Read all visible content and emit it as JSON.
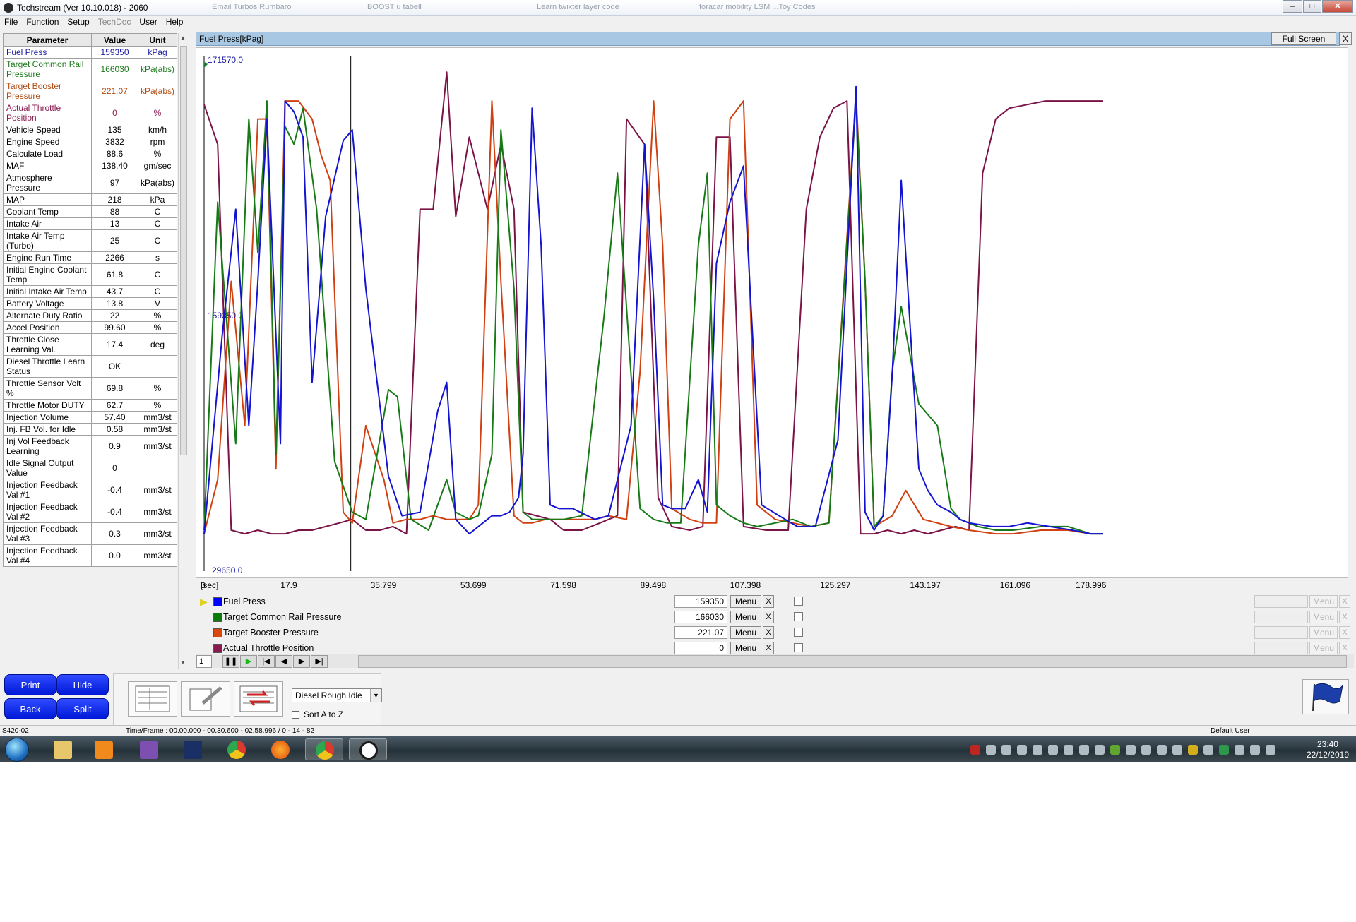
{
  "window": {
    "title": "Techstream (Ver 10.10.018) - 2060",
    "background_tabs": [
      "Email Turbos Rumbaro",
      "BOOST u tabell",
      "Learn twixter layer code",
      "foracar mobility LSM ...Toy Codes"
    ]
  },
  "menu": {
    "file": "File",
    "function": "Function",
    "setup": "Setup",
    "techdoc": "TechDoc",
    "user": "User",
    "help": "Help"
  },
  "table": {
    "headers": {
      "parameter": "Parameter",
      "value": "Value",
      "unit": "Unit"
    },
    "rows": [
      {
        "p": "Fuel Press",
        "v": "159350",
        "u": "kPag",
        "color": "#1a1aa0"
      },
      {
        "p": "Target Common Rail Pressure",
        "v": "166030",
        "u": "kPa(abs)",
        "color": "#1d7a1d"
      },
      {
        "p": "Target Booster Pressure",
        "v": "221.07",
        "u": "kPa(abs)",
        "color": "#b24a12"
      },
      {
        "p": "Actual Throttle Position",
        "v": "0",
        "u": "%",
        "color": "#8a1a4e"
      },
      {
        "p": "Vehicle Speed",
        "v": "135",
        "u": "km/h",
        "color": "#000000"
      },
      {
        "p": "Engine Speed",
        "v": "3832",
        "u": "rpm",
        "color": "#000000"
      },
      {
        "p": "Calculate Load",
        "v": "88.6",
        "u": "%",
        "color": "#000000"
      },
      {
        "p": "MAF",
        "v": "138.40",
        "u": "gm/sec",
        "color": "#000000"
      },
      {
        "p": "Atmosphere Pressure",
        "v": "97",
        "u": "kPa(abs)",
        "color": "#000000"
      },
      {
        "p": "MAP",
        "v": "218",
        "u": "kPa",
        "color": "#000000"
      },
      {
        "p": "Coolant Temp",
        "v": "88",
        "u": "C",
        "color": "#000000"
      },
      {
        "p": "Intake Air",
        "v": "13",
        "u": "C",
        "color": "#000000"
      },
      {
        "p": "Intake Air Temp (Turbo)",
        "v": "25",
        "u": "C",
        "color": "#000000"
      },
      {
        "p": "Engine Run Time",
        "v": "2266",
        "u": "s",
        "color": "#000000"
      },
      {
        "p": "Initial Engine Coolant Temp",
        "v": "61.8",
        "u": "C",
        "color": "#000000"
      },
      {
        "p": "Initial Intake Air Temp",
        "v": "43.7",
        "u": "C",
        "color": "#000000"
      },
      {
        "p": "Battery Voltage",
        "v": "13.8",
        "u": "V",
        "color": "#000000"
      },
      {
        "p": "Alternate Duty Ratio",
        "v": "22",
        "u": "%",
        "color": "#000000"
      },
      {
        "p": "Accel Position",
        "v": "99.60",
        "u": "%",
        "color": "#000000"
      },
      {
        "p": "Throttle Close Learning Val.",
        "v": "17.4",
        "u": "deg",
        "color": "#000000"
      },
      {
        "p": "Diesel Throttle Learn Status",
        "v": "OK",
        "u": "",
        "color": "#000000"
      },
      {
        "p": "Throttle Sensor Volt %",
        "v": "69.8",
        "u": "%",
        "color": "#000000"
      },
      {
        "p": "Throttle Motor DUTY",
        "v": "62.7",
        "u": "%",
        "color": "#000000"
      },
      {
        "p": "Injection Volume",
        "v": "57.40",
        "u": "mm3/st",
        "color": "#000000"
      },
      {
        "p": "Inj. FB Vol. for Idle",
        "v": "0.58",
        "u": "mm3/st",
        "color": "#000000"
      },
      {
        "p": "Inj Vol Feedback Learning",
        "v": "0.9",
        "u": "mm3/st",
        "color": "#000000"
      },
      {
        "p": "Idle Signal Output Value",
        "v": "0",
        "u": "",
        "color": "#000000"
      },
      {
        "p": "Injection Feedback Val #1",
        "v": "-0.4",
        "u": "mm3/st",
        "color": "#000000"
      },
      {
        "p": "Injection Feedback Val #2",
        "v": "-0.4",
        "u": "mm3/st",
        "color": "#000000"
      },
      {
        "p": "Injection Feedback Val #3",
        "v": "0.3",
        "u": "mm3/st",
        "color": "#000000"
      },
      {
        "p": "Injection Feedback Val #4",
        "v": "0.0",
        "u": "mm3/st",
        "color": "#000000"
      }
    ]
  },
  "graph": {
    "title": "Fuel Press[kPag]",
    "full_screen_label": "Full Screen",
    "close_label": "X",
    "cursor_time": 29.2
  },
  "chart_data": {
    "type": "line",
    "ylim": [
      29650.0,
      171570.0
    ],
    "y_ticks": [
      "171570.0",
      "159350.0",
      "29650.0"
    ],
    "xlim": [
      0,
      178.996
    ],
    "x_unit_label": "[sec]",
    "x_ticks": [
      "0",
      "17.9",
      "35.799",
      "53.699",
      "71.598",
      "89.498",
      "107.398",
      "125.297",
      "143.197",
      "161.096",
      "178.996"
    ],
    "grid": false,
    "series": [
      {
        "name": "Fuel Press",
        "color": "#1414d0",
        "x": [
          0,
          3.6,
          6.3,
          8.9,
          10.7,
          12.5,
          15.2,
          16.1,
          17.9,
          19.7,
          21.5,
          24.2,
          27.7,
          29.5,
          32.2,
          36.7,
          39.4,
          43.0,
          46.5,
          48.3,
          50.1,
          52.8,
          55.5,
          57.3,
          59.1,
          60.8,
          62.6,
          63.5,
          65.3,
          67.1,
          68.9,
          70.7,
          73.4,
          77.8,
          80.5,
          85.0,
          87.7,
          89.5,
          91.3,
          93.1,
          95.8,
          98.4,
          100.2,
          102.0,
          104.7,
          107.4,
          111.0,
          114.5,
          118.1,
          121.7,
          126.2,
          129.8,
          131.6,
          133.4,
          135.2,
          137.0,
          138.8,
          142.3,
          144.1,
          146.0,
          148.7,
          150.5,
          152.3,
          156.8,
          160.3,
          163.9,
          168.4,
          172.9,
          176.5,
          179.0
        ],
        "y": [
          40000,
          95000,
          130000,
          70000,
          110000,
          155000,
          65000,
          160000,
          157000,
          150000,
          82000,
          128000,
          149000,
          152000,
          108000,
          56000,
          45000,
          46000,
          74000,
          82000,
          44000,
          40000,
          43000,
          45000,
          45000,
          46000,
          50000,
          62000,
          158000,
          120000,
          48000,
          47000,
          47000,
          44000,
          45000,
          70000,
          148000,
          105000,
          48000,
          47000,
          47000,
          55000,
          46000,
          115000,
          132000,
          142000,
          48000,
          45000,
          42000,
          42000,
          66000,
          164000,
          46000,
          41000,
          45000,
          84000,
          138000,
          58000,
          52000,
          48000,
          46000,
          44000,
          43000,
          42000,
          42000,
          43000,
          42000,
          41000,
          40000,
          40000
        ]
      },
      {
        "name": "Target Common Rail Pressure",
        "color": "#177a17",
        "x": [
          0,
          2.7,
          6.3,
          8.9,
          10.7,
          12.5,
          14.3,
          16.1,
          17.9,
          19.7,
          22.4,
          26.0,
          29.5,
          32.2,
          36.7,
          38.5,
          41.2,
          44.7,
          48.3,
          50.1,
          52.8,
          54.6,
          57.3,
          59.1,
          61.7,
          63.5,
          65.3,
          67.1,
          68.9,
          71.6,
          75.2,
          79.6,
          82.3,
          86.8,
          89.5,
          92.2,
          94.9,
          98.4,
          100.2,
          102.0,
          104.7,
          107.4,
          110.1,
          113.7,
          117.2,
          120.8,
          124.4,
          129.8,
          131.6,
          133.4,
          135.2,
          137.0,
          138.8,
          142.3,
          146.0,
          148.7,
          150.5,
          154.1,
          157.6,
          161.1,
          166.6,
          172.0,
          176.5,
          179.0
        ],
        "y": [
          41000,
          132000,
          65000,
          155000,
          118000,
          160000,
          62000,
          153000,
          148000,
          158000,
          130000,
          60000,
          46000,
          44000,
          80000,
          78000,
          44000,
          41000,
          55000,
          46000,
          44000,
          45000,
          62000,
          152000,
          108000,
          46000,
          44000,
          44000,
          44000,
          44000,
          45000,
          100000,
          140000,
          47000,
          44000,
          43000,
          43000,
          120000,
          140000,
          48000,
          45000,
          43000,
          42000,
          43000,
          44000,
          42000,
          43000,
          160000,
          110000,
          42000,
          45000,
          85000,
          103000,
          76000,
          70000,
          47000,
          44000,
          42000,
          41000,
          41000,
          42000,
          42000,
          40000,
          40000
        ]
      },
      {
        "name": "Target Booster Pressure",
        "color": "#d04010",
        "x": [
          0,
          2.7,
          5.4,
          8.1,
          10.7,
          12.5,
          14.3,
          16.1,
          18.8,
          21.5,
          23.3,
          25.1,
          27.7,
          29.5,
          32.2,
          35.8,
          37.6,
          40.3,
          43.0,
          45.6,
          48.3,
          50.1,
          52.8,
          54.6,
          57.3,
          59.1,
          61.7,
          63.5,
          65.3,
          68.0,
          70.7,
          73.4,
          77.8,
          80.5,
          84.1,
          86.8,
          89.5,
          91.3,
          93.1,
          96.7,
          99.3,
          102.0,
          104.7,
          107.4,
          110.1,
          113.7,
          117.2,
          120.8,
          124.4,
          129.8,
          131.6,
          133.4,
          137.0,
          139.7,
          143.2,
          146.0,
          148.7,
          152.3,
          157.6,
          161.1,
          166.6,
          172.0,
          176.5,
          179.0
        ],
        "y": [
          40000,
          55000,
          110000,
          70000,
          155000,
          155000,
          58000,
          160000,
          160000,
          155000,
          145000,
          138000,
          46000,
          43000,
          70000,
          55000,
          43000,
          44000,
          44000,
          45000,
          44000,
          44000,
          44000,
          48000,
          160000,
          110000,
          45000,
          43000,
          43000,
          44000,
          44000,
          44000,
          44000,
          45000,
          44000,
          85000,
          160000,
          120000,
          47000,
          44000,
          43000,
          43000,
          155000,
          160000,
          48000,
          44000,
          43000,
          42000,
          43000,
          162000,
          110000,
          42000,
          45000,
          52000,
          44000,
          43000,
          42000,
          41000,
          40000,
          40000,
          41000,
          41000,
          40000,
          40000
        ]
      },
      {
        "name": "Actual Throttle Position",
        "color": "#7a1346",
        "x": [
          0,
          2.7,
          5.4,
          8.1,
          10.7,
          13.4,
          16.1,
          18.8,
          21.5,
          24.2,
          26.9,
          29.5,
          32.2,
          35.0,
          37.6,
          40.3,
          43.0,
          45.6,
          48.3,
          50.1,
          52.8,
          56.4,
          59.1,
          61.7,
          63.5,
          66.2,
          68.9,
          71.6,
          75.2,
          78.8,
          82.3,
          84.1,
          87.7,
          90.4,
          93.1,
          96.7,
          99.3,
          102.0,
          104.7,
          107.4,
          111.9,
          116.3,
          119.9,
          122.6,
          125.3,
          128.0,
          130.7,
          133.4,
          136.1,
          138.8,
          141.4,
          144.1,
          146.8,
          149.6,
          152.3,
          155.0,
          157.6,
          160.3,
          163.9,
          167.5,
          171.0,
          174.6,
          177.3,
          179.0
        ],
        "y": [
          159000,
          148000,
          41000,
          40000,
          41000,
          40000,
          40000,
          41000,
          41000,
          42000,
          43000,
          44000,
          41000,
          41000,
          42000,
          40000,
          130000,
          130000,
          168000,
          128000,
          150000,
          130000,
          148000,
          130000,
          46000,
          45000,
          44000,
          41000,
          41000,
          43000,
          45000,
          155000,
          148000,
          50000,
          42000,
          41000,
          42000,
          150000,
          150000,
          42000,
          41000,
          41000,
          130000,
          150000,
          158000,
          160000,
          40000,
          40000,
          41000,
          40000,
          41000,
          40000,
          41000,
          42000,
          41000,
          140000,
          155000,
          158000,
          159000,
          160000,
          160000,
          160000,
          160000,
          160000
        ]
      }
    ]
  },
  "legend": [
    {
      "name": "Fuel Press",
      "value": "159350",
      "color": "#0000ff",
      "selected": true
    },
    {
      "name": "Target Common Rail Pressure",
      "value": "166030",
      "color": "#0a7a0a",
      "selected": false
    },
    {
      "name": "Target Booster Pressure",
      "value": "221.07",
      "color": "#d8480e",
      "selected": false
    },
    {
      "name": "Actual Throttle Position",
      "value": "0",
      "color": "#8a1a4e",
      "selected": false
    }
  ],
  "legend_labels": {
    "menu": "Menu",
    "x": "X"
  },
  "playback": {
    "frame": "1"
  },
  "bottom": {
    "print": "Print",
    "hide": "Hide",
    "back": "Back",
    "split": "Split",
    "dropdown_value": "Diesel Rough Idle",
    "sort_label": "Sort A to Z"
  },
  "status": {
    "left": "S420-02",
    "timeframe": "Time/Frame : 00.00.000 - 00.30.600 - 02.58.996 / 0 - 14 - 82",
    "user": "Default User"
  },
  "taskbar": {
    "time": "23:40",
    "date": "22/12/2019"
  }
}
